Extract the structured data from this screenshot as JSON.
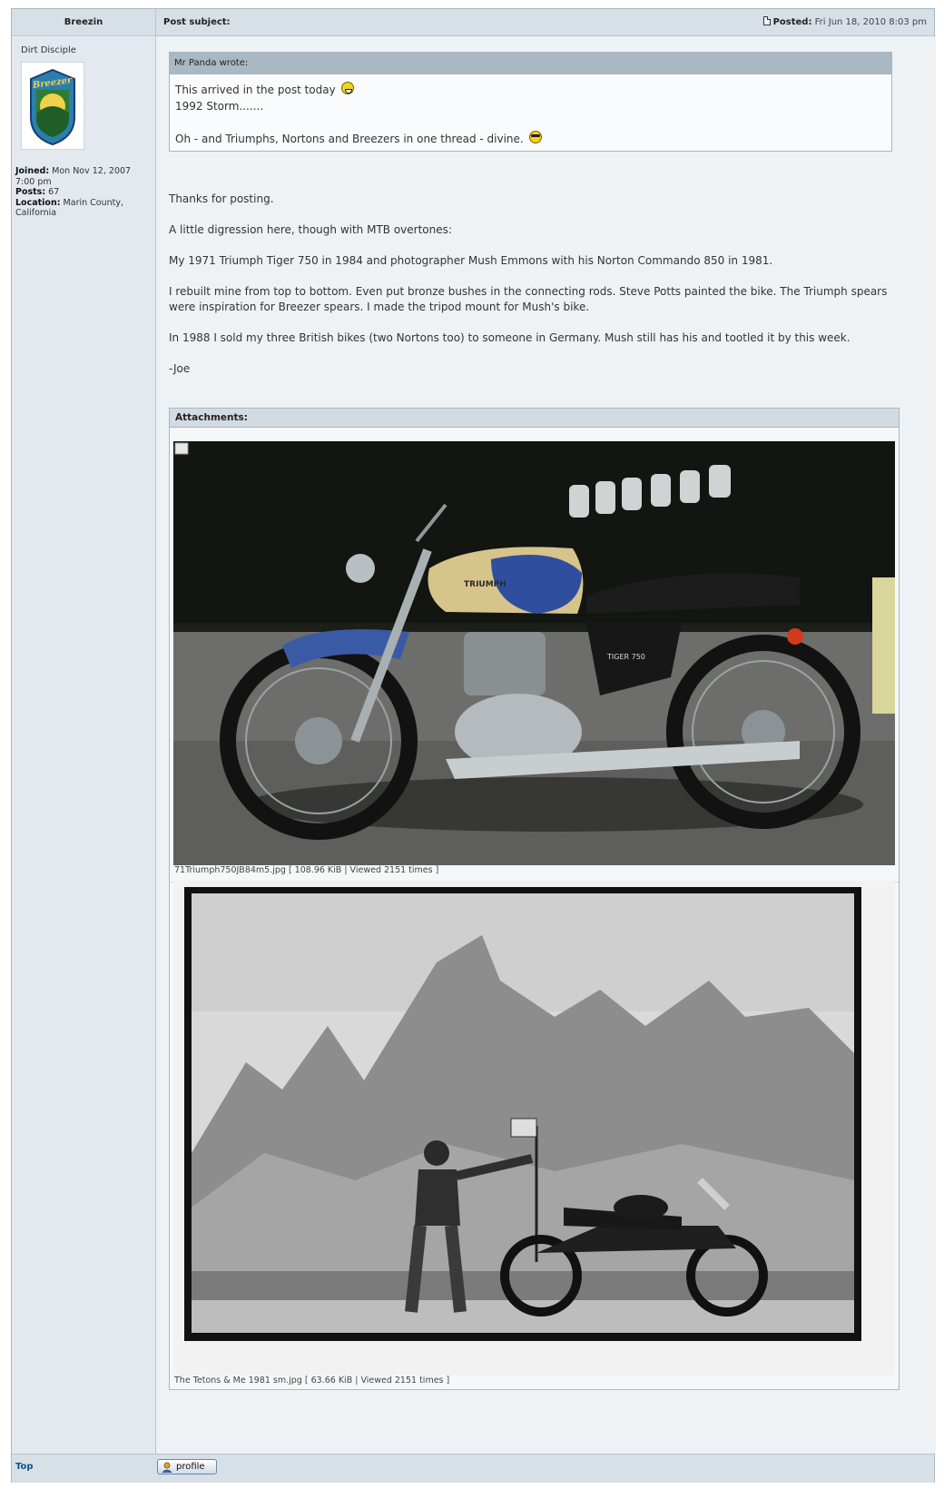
{
  "header": {
    "author": "Breezin",
    "subject_label": "Post subject:",
    "posted_label": "Posted:",
    "posted_date": "Fri Jun 18, 2010 8:03 pm"
  },
  "profile": {
    "rank": "Dirt Disciple",
    "avatar_text": "Breezer",
    "joined_label": "Joined:",
    "joined_value": "Mon Nov 12, 2007 7:00 pm",
    "posts_label": "Posts:",
    "posts_value": "67",
    "location_label": "Location:",
    "location_value": "Marin County, California"
  },
  "quote": {
    "author_line": "Mr Panda wrote:",
    "line1": "This arrived in the post today",
    "line2": "1992 Storm.......",
    "line3": "Oh - and Triumphs, Nortons and Breezers in one thread - divine."
  },
  "post": {
    "p1": "Thanks for posting.",
    "p2": "A little digression here, though with MTB overtones:",
    "p3": "My 1971 Triumph Tiger 750 in 1984 and photographer Mush Emmons with his Norton Commando 850 in 1981.",
    "p4": "I rebuilt mine from top to bottom. Even put bronze bushes in the connecting rods. Steve Potts painted the bike. The Triumph spears were inspiration for Breezer spears. I made the tripod mount for Mush's bike.",
    "p5": "In 1988 I sold my three British bikes (two Nortons too) to someone in Germany. Mush still has his and tootled it by this week.",
    "signature": "-Joe"
  },
  "attachments": {
    "title": "Attachments:",
    "files": [
      {
        "caption": "71Triumph750JB84m5.jpg [ 108.96 KiB | Viewed 2151 times ]",
        "tank_badge": "TRIUMPH",
        "panel_badge": "TIGER 750"
      },
      {
        "caption": "The Tetons & Me 1981 sm.jpg [ 63.66 KiB | Viewed 2151 times ]"
      }
    ]
  },
  "footer": {
    "top_link": "Top",
    "profile_button": "profile"
  },
  "colors": {
    "header_bg": "#d7dfe7",
    "post_bg": "#eef2f5",
    "profile_bg": "#e3e9ee",
    "quote_head": "#a9b8c2",
    "link": "#105289"
  }
}
